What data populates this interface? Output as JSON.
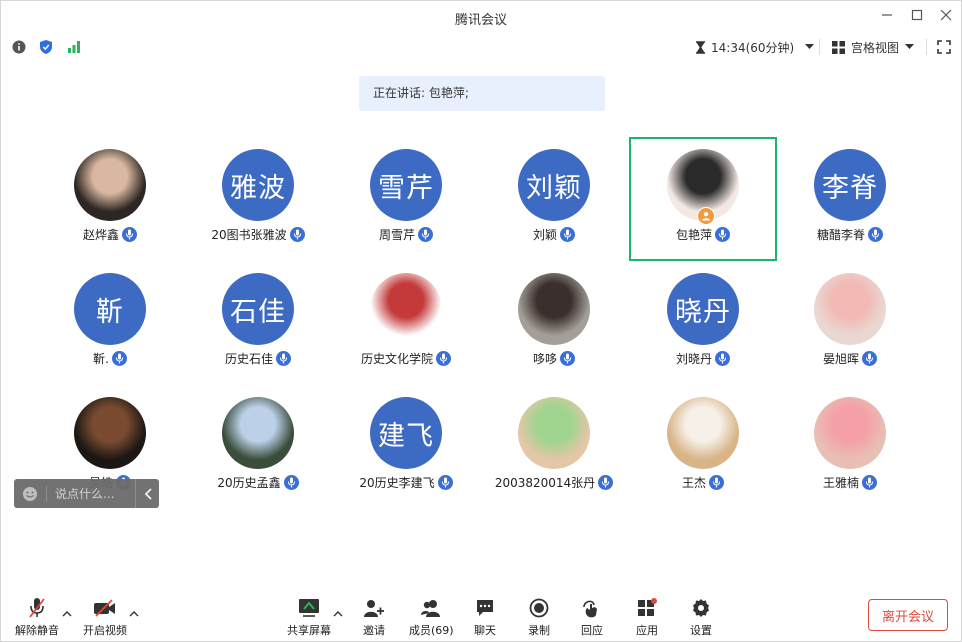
{
  "window": {
    "title": "腾讯会议"
  },
  "toolbar_top": {
    "timer": "14:34(60分钟)",
    "view_label": "宫格视图"
  },
  "speaking": "正在讲话: 包艳萍;",
  "colors": {
    "avatar_blue": "#3d6bc4",
    "active_border": "#19b56b",
    "mic_blue": "#3a6fd8",
    "leave_red": "#e0483b"
  },
  "participants": [
    {
      "name": "赵烨鑫",
      "avatar_type": "photo"
    },
    {
      "name": "20图书张雅波",
      "avatar_text": "雅波"
    },
    {
      "name": "周雪芹",
      "avatar_text": "雪芹"
    },
    {
      "name": "刘颖",
      "avatar_text": "刘颖"
    },
    {
      "name": "包艳萍",
      "avatar_type": "photo",
      "active": true,
      "host": true
    },
    {
      "name": "糖醋李脊",
      "avatar_text": "李脊"
    },
    {
      "name": "靳.",
      "avatar_text": "靳"
    },
    {
      "name": "历史石佳",
      "avatar_text": "石佳"
    },
    {
      "name": "历史文化学院",
      "avatar_type": "photo"
    },
    {
      "name": "哆哆",
      "avatar_type": "photo"
    },
    {
      "name": "刘晓丹",
      "avatar_text": "晓丹"
    },
    {
      "name": "晏旭晖",
      "avatar_type": "photo"
    },
    {
      "name": "吴皓",
      "avatar_type": "photo"
    },
    {
      "name": "20历史孟鑫",
      "avatar_type": "photo"
    },
    {
      "name": "20历史李建飞",
      "avatar_text": "建飞"
    },
    {
      "name": "2003820014张丹",
      "avatar_type": "photo"
    },
    {
      "name": "王杰",
      "avatar_type": "photo"
    },
    {
      "name": "王雅楠",
      "avatar_type": "photo"
    }
  ],
  "chat_popup": {
    "placeholder": "说点什么..."
  },
  "bottom": {
    "unmute": "解除静音",
    "video": "开启视频",
    "share": "共享屏幕",
    "invite": "邀请",
    "members": "成员(69)",
    "chat": "聊天",
    "record": "录制",
    "react": "回应",
    "apps": "应用",
    "settings": "设置",
    "leave": "离开会议"
  }
}
